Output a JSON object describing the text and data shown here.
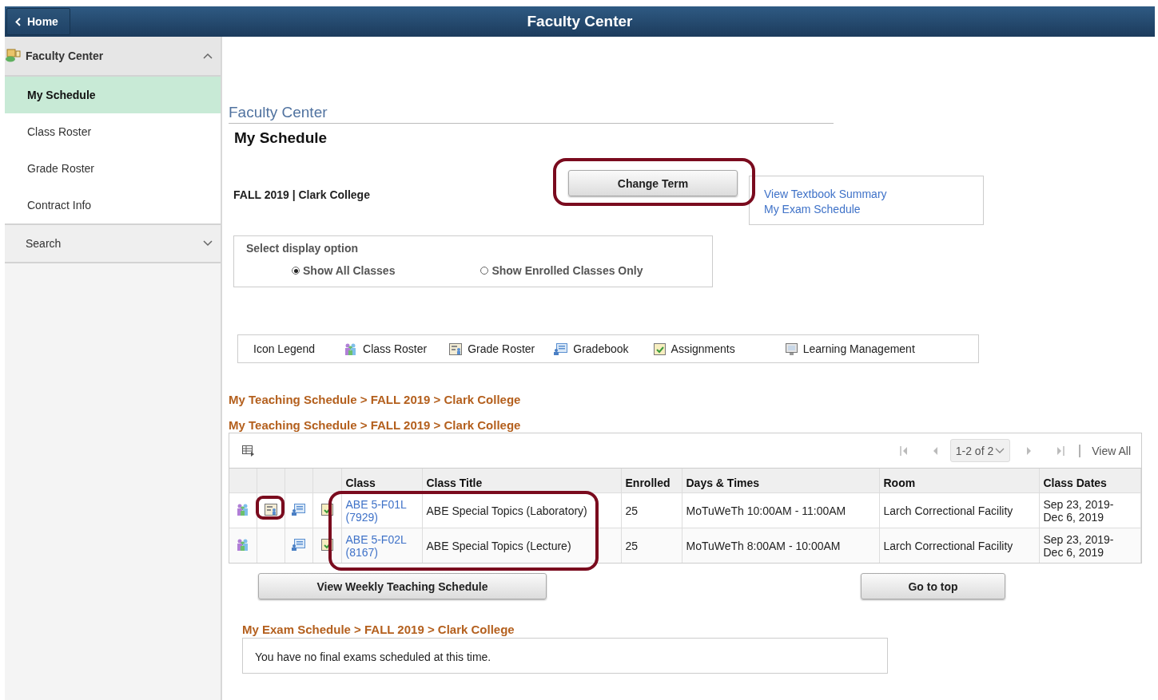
{
  "header": {
    "home_button": "Home",
    "title": "Faculty Center"
  },
  "sidebar": {
    "group": {
      "label": "Faculty Center",
      "expanded": true
    },
    "items": [
      {
        "label": "My Schedule",
        "selected": true
      },
      {
        "label": "Class Roster",
        "selected": false
      },
      {
        "label": "Grade Roster",
        "selected": false
      },
      {
        "label": "Contract Info",
        "selected": false
      }
    ],
    "search": {
      "label": "Search",
      "expanded": false
    }
  },
  "page": {
    "breadcrumb": "Faculty Center",
    "title": "My Schedule",
    "term": "FALL 2019 | Clark College",
    "change_term": {
      "label": "Change Term",
      "highlighted": true
    },
    "links": [
      "View Textbook Summary",
      "My Exam Schedule"
    ],
    "display_option": {
      "label": "Select display option",
      "options": [
        {
          "label": "Show All Classes",
          "selected": true
        },
        {
          "label": "Show Enrolled Classes Only",
          "selected": false
        }
      ]
    },
    "legend": {
      "label": "Icon Legend",
      "items": [
        {
          "kind": "class-roster",
          "label": "Class Roster"
        },
        {
          "kind": "grade-roster",
          "label": "Grade Roster"
        },
        {
          "kind": "gradebook",
          "label": "Gradebook"
        },
        {
          "kind": "assignments",
          "label": "Assignments"
        },
        {
          "kind": "learning",
          "label": "Learning Management"
        }
      ]
    },
    "teaching_headings": [
      "My Teaching Schedule > FALL 2019 > Clark College",
      "My Teaching Schedule > FALL 2019 > Clark College"
    ],
    "table": {
      "pager": "1-2 of 2",
      "view_all": "View All",
      "class_highlight": true,
      "columns": [
        "Class",
        "Class Title",
        "Enrolled",
        "Days & Times",
        "Room",
        "Class Dates"
      ],
      "rows": [
        {
          "class_roster": true,
          "grade_roster": true,
          "grade_roster_highlighted": true,
          "gradebook": true,
          "assignments": true,
          "class": "ABE 5-F01L",
          "class_number": "(7929)",
          "title": "ABE Special Topics (Laboratory)",
          "enrolled": "25",
          "days_times": "MoTuWeTh 10:00AM - 11:00AM",
          "room": "Larch Correctional Facility",
          "dates_start": "Sep 23, 2019-",
          "dates_end": "Dec 6, 2019"
        },
        {
          "class_roster": true,
          "grade_roster": false,
          "grade_roster_highlighted": false,
          "gradebook": true,
          "assignments": true,
          "class": "ABE 5-F02L",
          "class_number": "(8167)",
          "title": "ABE Special Topics (Lecture)",
          "enrolled": "25",
          "days_times": "MoTuWeTh 8:00AM - 10:00AM",
          "room": "Larch Correctional Facility",
          "dates_start": "Sep 23, 2019-",
          "dates_end": "Dec 6, 2019"
        }
      ]
    },
    "weekly_button": "View Weekly Teaching Schedule",
    "top_button": "Go to top",
    "exam_heading": "My Exam Schedule > FALL 2019 > Clark College",
    "exam_message": "You have no final exams scheduled at this time."
  }
}
